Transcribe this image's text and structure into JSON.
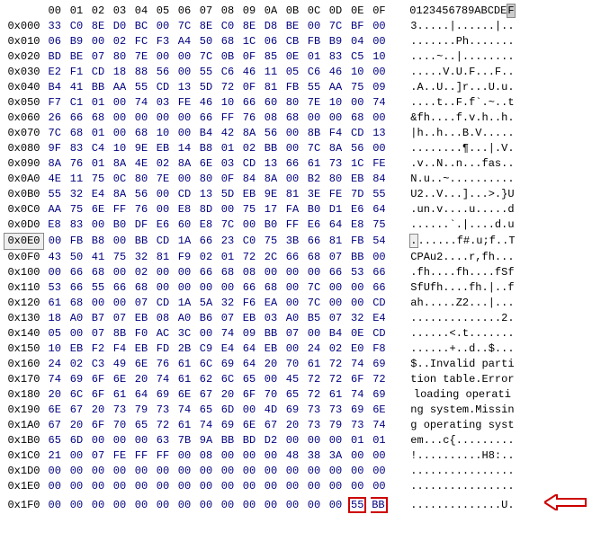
{
  "columns": [
    "00",
    "01",
    "02",
    "03",
    "04",
    "05",
    "06",
    "07",
    "08",
    "09",
    "0A",
    "0B",
    "0C",
    "0D",
    "0E",
    "0F"
  ],
  "ascii_header": "0123456789ABCDE",
  "ascii_header_last": "F",
  "rows": [
    {
      "off": "0x000",
      "h": [
        "33",
        "C0",
        "8E",
        "D0",
        "BC",
        "00",
        "7C",
        "8E",
        "C0",
        "8E",
        "D8",
        "BE",
        "00",
        "7C",
        "BF",
        "00"
      ],
      "a": "3.....|......|.."
    },
    {
      "off": "0x010",
      "h": [
        "06",
        "B9",
        "00",
        "02",
        "FC",
        "F3",
        "A4",
        "50",
        "68",
        "1C",
        "06",
        "CB",
        "FB",
        "B9",
        "04",
        "00"
      ],
      "a": ".......Ph......."
    },
    {
      "off": "0x020",
      "h": [
        "BD",
        "BE",
        "07",
        "80",
        "7E",
        "00",
        "00",
        "7C",
        "0B",
        "0F",
        "85",
        "0E",
        "01",
        "83",
        "C5",
        "10"
      ],
      "a": "....~..|........"
    },
    {
      "off": "0x030",
      "h": [
        "E2",
        "F1",
        "CD",
        "18",
        "88",
        "56",
        "00",
        "55",
        "C6",
        "46",
        "11",
        "05",
        "C6",
        "46",
        "10",
        "00"
      ],
      "a": ".....V.U.F...F.."
    },
    {
      "off": "0x040",
      "h": [
        "B4",
        "41",
        "BB",
        "AA",
        "55",
        "CD",
        "13",
        "5D",
        "72",
        "0F",
        "81",
        "FB",
        "55",
        "AA",
        "75",
        "09"
      ],
      "a": ".A..U..]r...U.u."
    },
    {
      "off": "0x050",
      "h": [
        "F7",
        "C1",
        "01",
        "00",
        "74",
        "03",
        "FE",
        "46",
        "10",
        "66",
        "60",
        "80",
        "7E",
        "10",
        "00",
        "74"
      ],
      "a": "....t..F.f`.~..t"
    },
    {
      "off": "0x060",
      "h": [
        "26",
        "66",
        "68",
        "00",
        "00",
        "00",
        "00",
        "66",
        "FF",
        "76",
        "08",
        "68",
        "00",
        "00",
        "68",
        "00"
      ],
      "a": "&fh....f.v.h..h."
    },
    {
      "off": "0x070",
      "h": [
        "7C",
        "68",
        "01",
        "00",
        "68",
        "10",
        "00",
        "B4",
        "42",
        "8A",
        "56",
        "00",
        "8B",
        "F4",
        "CD",
        "13"
      ],
      "a": "|h..h...B.V....."
    },
    {
      "off": "0x080",
      "h": [
        "9F",
        "83",
        "C4",
        "10",
        "9E",
        "EB",
        "14",
        "B8",
        "01",
        "02",
        "BB",
        "00",
        "7C",
        "8A",
        "56",
        "00"
      ],
      "a": "........¶...|.V."
    },
    {
      "off": "0x090",
      "h": [
        "8A",
        "76",
        "01",
        "8A",
        "4E",
        "02",
        "8A",
        "6E",
        "03",
        "CD",
        "13",
        "66",
        "61",
        "73",
        "1C",
        "FE"
      ],
      "a": ".v..N..n...fas.."
    },
    {
      "off": "0x0A0",
      "h": [
        "4E",
        "11",
        "75",
        "0C",
        "80",
        "7E",
        "00",
        "80",
        "0F",
        "84",
        "8A",
        "00",
        "B2",
        "80",
        "EB",
        "84"
      ],
      "a": "N.u..~.........."
    },
    {
      "off": "0x0B0",
      "h": [
        "55",
        "32",
        "E4",
        "8A",
        "56",
        "00",
        "CD",
        "13",
        "5D",
        "EB",
        "9E",
        "81",
        "3E",
        "FE",
        "7D",
        "55"
      ],
      "a": "U2..V...]...>.}U"
    },
    {
      "off": "0x0C0",
      "h": [
        "AA",
        "75",
        "6E",
        "FF",
        "76",
        "00",
        "E8",
        "8D",
        "00",
        "75",
        "17",
        "FA",
        "B0",
        "D1",
        "E6",
        "64"
      ],
      "a": ".un.v....u.....d"
    },
    {
      "off": "0x0D0",
      "h": [
        "E8",
        "83",
        "00",
        "B0",
        "DF",
        "E6",
        "60",
        "E8",
        "7C",
        "00",
        "B0",
        "FF",
        "E6",
        "64",
        "E8",
        "75"
      ],
      "a": "......`.|....d.u"
    },
    {
      "off": "0x0E0",
      "h": [
        "00",
        "FB",
        "B8",
        "00",
        "BB",
        "CD",
        "1A",
        "66",
        "23",
        "C0",
        "75",
        "3B",
        "66",
        "81",
        "FB",
        "54"
      ],
      "a": ".......f#.u;f..T",
      "hl": true
    },
    {
      "off": "0x0F0",
      "h": [
        "43",
        "50",
        "41",
        "75",
        "32",
        "81",
        "F9",
        "02",
        "01",
        "72",
        "2C",
        "66",
        "68",
        "07",
        "BB",
        "00"
      ],
      "a": "CPAu2....r,fh..."
    },
    {
      "off": "0x100",
      "h": [
        "00",
        "66",
        "68",
        "00",
        "02",
        "00",
        "00",
        "66",
        "68",
        "08",
        "00",
        "00",
        "00",
        "66",
        "53",
        "66"
      ],
      "a": ".fh....fh....fSf"
    },
    {
      "off": "0x110",
      "h": [
        "53",
        "66",
        "55",
        "66",
        "68",
        "00",
        "00",
        "00",
        "00",
        "66",
        "68",
        "00",
        "7C",
        "00",
        "00",
        "66"
      ],
      "a": "SfUfh....fh.|..f"
    },
    {
      "off": "0x120",
      "h": [
        "61",
        "68",
        "00",
        "00",
        "07",
        "CD",
        "1A",
        "5A",
        "32",
        "F6",
        "EA",
        "00",
        "7C",
        "00",
        "00",
        "CD"
      ],
      "a": "ah.....Z2...|..."
    },
    {
      "off": "0x130",
      "h": [
        "18",
        "A0",
        "B7",
        "07",
        "EB",
        "08",
        "A0",
        "B6",
        "07",
        "EB",
        "03",
        "A0",
        "B5",
        "07",
        "32",
        "E4"
      ],
      "a": "..............2."
    },
    {
      "off": "0x140",
      "h": [
        "05",
        "00",
        "07",
        "8B",
        "F0",
        "AC",
        "3C",
        "00",
        "74",
        "09",
        "BB",
        "07",
        "00",
        "B4",
        "0E",
        "CD"
      ],
      "a": "......<.t......."
    },
    {
      "off": "0x150",
      "h": [
        "10",
        "EB",
        "F2",
        "F4",
        "EB",
        "FD",
        "2B",
        "C9",
        "E4",
        "64",
        "EB",
        "00",
        "24",
        "02",
        "E0",
        "F8"
      ],
      "a": "......+..d..$..."
    },
    {
      "off": "0x160",
      "h": [
        "24",
        "02",
        "C3",
        "49",
        "6E",
        "76",
        "61",
        "6C",
        "69",
        "64",
        "20",
        "70",
        "61",
        "72",
        "74",
        "69"
      ],
      "a": "$..Invalid parti"
    },
    {
      "off": "0x170",
      "h": [
        "74",
        "69",
        "6F",
        "6E",
        "20",
        "74",
        "61",
        "62",
        "6C",
        "65",
        "00",
        "45",
        "72",
        "72",
        "6F",
        "72"
      ],
      "a": "tion table.Error"
    },
    {
      "off": "0x180",
      "h": [
        "20",
        "6C",
        "6F",
        "61",
        "64",
        "69",
        "6E",
        "67",
        "20",
        "6F",
        "70",
        "65",
        "72",
        "61",
        "74",
        "69"
      ],
      "a": " loading operati"
    },
    {
      "off": "0x190",
      "h": [
        "6E",
        "67",
        "20",
        "73",
        "79",
        "73",
        "74",
        "65",
        "6D",
        "00",
        "4D",
        "69",
        "73",
        "73",
        "69",
        "6E"
      ],
      "a": "ng system.Missin"
    },
    {
      "off": "0x1A0",
      "h": [
        "67",
        "20",
        "6F",
        "70",
        "65",
        "72",
        "61",
        "74",
        "69",
        "6E",
        "67",
        "20",
        "73",
        "79",
        "73",
        "74"
      ],
      "a": "g operating syst"
    },
    {
      "off": "0x1B0",
      "h": [
        "65",
        "6D",
        "00",
        "00",
        "00",
        "63",
        "7B",
        "9A",
        "BB",
        "BD",
        "D2",
        "00",
        "00",
        "00",
        "01",
        "01"
      ],
      "a": "em...c{........."
    },
    {
      "off": "0x1C0",
      "h": [
        "21",
        "00",
        "07",
        "FE",
        "FF",
        "FF",
        "00",
        "08",
        "00",
        "00",
        "00",
        "48",
        "38",
        "3A",
        "00",
        "00"
      ],
      "a": "!..........H8:.."
    },
    {
      "off": "0x1D0",
      "h": [
        "00",
        "00",
        "00",
        "00",
        "00",
        "00",
        "00",
        "00",
        "00",
        "00",
        "00",
        "00",
        "00",
        "00",
        "00",
        "00"
      ],
      "a": "................"
    },
    {
      "off": "0x1E0",
      "h": [
        "00",
        "00",
        "00",
        "00",
        "00",
        "00",
        "00",
        "00",
        "00",
        "00",
        "00",
        "00",
        "00",
        "00",
        "00",
        "00"
      ],
      "a": "................"
    },
    {
      "off": "0x1F0",
      "h": [
        "00",
        "00",
        "00",
        "00",
        "00",
        "00",
        "00",
        "00",
        "00",
        "00",
        "00",
        "00",
        "00",
        "00",
        "55",
        "BB"
      ],
      "a": "..............U.",
      "box": [
        14,
        15
      ],
      "arrow": true
    }
  ]
}
